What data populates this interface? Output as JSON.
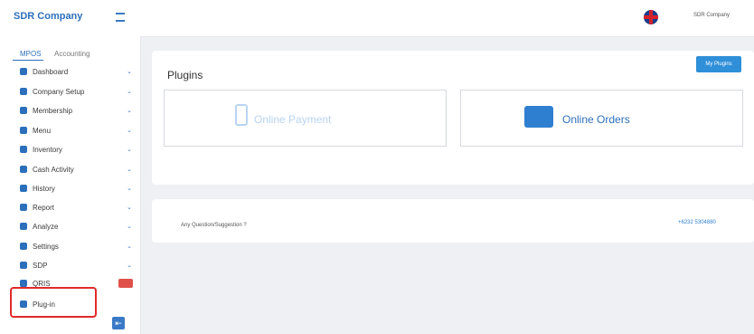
{
  "app": {
    "brand": "SDR Company",
    "user": "SDR Company"
  },
  "sidebar": {
    "tabs": [
      "MPOS",
      "Accounting"
    ],
    "items": [
      {
        "label": "Dashboard"
      },
      {
        "label": "Company Setup"
      },
      {
        "label": "Membership"
      },
      {
        "label": "Menu"
      },
      {
        "label": "Inventory"
      },
      {
        "label": "Cash Activity"
      },
      {
        "label": "History"
      },
      {
        "label": "Report"
      },
      {
        "label": "Analyze"
      },
      {
        "label": "Settings"
      },
      {
        "label": "SDP"
      },
      {
        "label": "QRIS"
      },
      {
        "label": "Plug-in"
      }
    ],
    "badge": "New"
  },
  "main": {
    "title": "Plugins",
    "my_plugins_button": "My Plugins",
    "plugins": [
      {
        "label": "Online Payment",
        "icon": "phone-icon"
      },
      {
        "label": "Online Orders",
        "icon": "store-icon"
      }
    ],
    "contact": {
      "question": "Any Question/Suggestion ?",
      "phone": "+6232 5304880"
    }
  },
  "colors": {
    "accent": "#2c6fbb",
    "highlight": "#e02a2a"
  }
}
